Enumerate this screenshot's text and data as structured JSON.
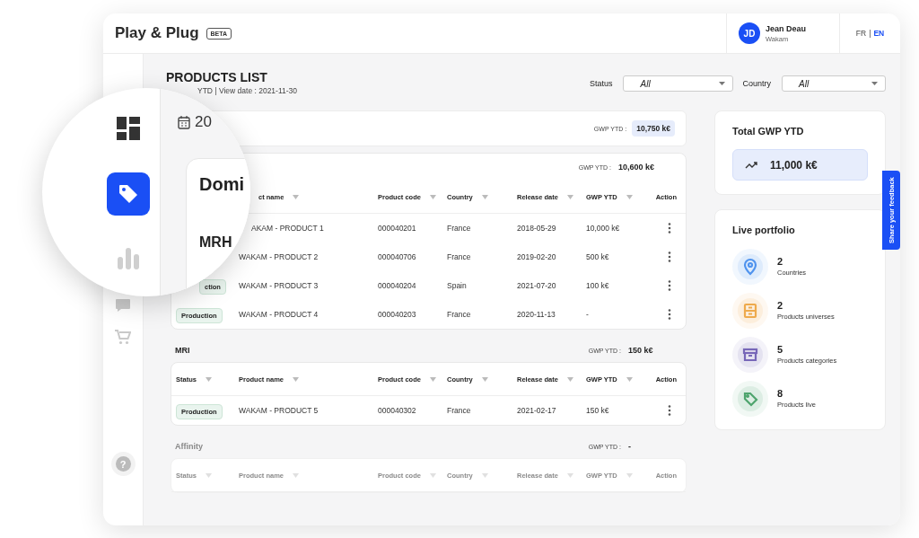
{
  "header": {
    "logo": "Play & Plug",
    "badge": "BETA",
    "user": {
      "initials": "JD",
      "name": "Jean Deau",
      "company": "Wakam"
    },
    "languages": [
      {
        "label": "FR",
        "selected": false
      },
      {
        "label": "EN",
        "selected": true
      }
    ],
    "separator": "|"
  },
  "sidebar": {
    "items": [
      {
        "kind": "chat"
      },
      {
        "kind": "cart"
      }
    ],
    "help": "?"
  },
  "magnifier": {
    "nav": [
      {
        "kind": "dashboard",
        "selected": false
      },
      {
        "kind": "tag",
        "selected": true
      },
      {
        "kind": "chart",
        "selected": false
      }
    ],
    "date": "20",
    "group_title": "Domi",
    "section_title": "MRH"
  },
  "page": {
    "title": "PRODUCTS LIST",
    "subtitle": "YTD | View date : 2021-11-30",
    "filters": [
      {
        "label": "Status",
        "value": "All"
      },
      {
        "label": "Country",
        "value": "All"
      }
    ]
  },
  "group": {
    "gwp_label": "GWP YTD :",
    "gwp": "10,750 k€",
    "sections": [
      {
        "kind": "card",
        "gwp_label": "GWP YTD :",
        "gwp": "10,600 k€",
        "dimmed": false,
        "columns": [
          {
            "label": "ct name",
            "filter": true
          },
          {
            "label": "Product code",
            "filter": true
          },
          {
            "label": "Country",
            "filter": true
          },
          {
            "label": "Release date",
            "filter": true
          },
          {
            "label": "GWP YTD",
            "filter": true
          },
          {
            "label": "Action",
            "filter": false
          }
        ],
        "rows": [
          {
            "name": "AKAM - PRODUCT 1",
            "code": "000040201",
            "country": "France",
            "date": "2018-05-29",
            "gwp": "10,000 k€"
          },
          {
            "name": "WAKAM - PRODUCT 2",
            "code": "000040706",
            "country": "France",
            "date": "2019-02-20",
            "gwp": "500 k€"
          },
          {
            "status": "ction",
            "name": "WAKAM - PRODUCT 3",
            "code": "000040204",
            "country": "Spain",
            "date": "2021-07-20",
            "gwp": "100 k€"
          },
          {
            "status": "Production",
            "name": "WAKAM - PRODUCT 4",
            "code": "000040203",
            "country": "France",
            "date": "2020-11-13",
            "gwp": "-"
          }
        ]
      },
      {
        "kind": "plain",
        "title": "MRI",
        "gwp_label": "GWP YTD :",
        "gwp": "150 k€",
        "dimmed": false,
        "columns": [
          {
            "label": "Status",
            "filter": true
          },
          {
            "label": "Product name",
            "filter": true
          },
          {
            "label": "Product code",
            "filter": true
          },
          {
            "label": "Country",
            "filter": true
          },
          {
            "label": "Release date",
            "filter": true
          },
          {
            "label": "GWP YTD",
            "filter": true
          },
          {
            "label": "Action",
            "filter": false
          }
        ],
        "rows": [
          {
            "status": "Production",
            "name": "WAKAM - PRODUCT 5",
            "code": "000040302",
            "country": "France",
            "date": "2021-02-17",
            "gwp": "150 k€"
          }
        ]
      },
      {
        "kind": "plain",
        "title": "Affinity",
        "gwp_label": "GWP YTD :",
        "gwp": "-",
        "dimmed": true,
        "columns": [
          {
            "label": "Status",
            "filter": true
          },
          {
            "label": "Product name",
            "filter": true
          },
          {
            "label": "Product code",
            "filter": true
          },
          {
            "label": "Country",
            "filter": true
          },
          {
            "label": "Release date",
            "filter": true
          },
          {
            "label": "GWP YTD",
            "filter": true
          },
          {
            "label": "Action",
            "filter": false
          }
        ]
      }
    ]
  },
  "summary": {
    "title": "Total GWP YTD",
    "value": "11,000 k€"
  },
  "portfolio": {
    "title": "Live portfolio",
    "items": [
      {
        "kind": "location",
        "value": "2",
        "label": "Countries",
        "color": "#4f93ee"
      },
      {
        "kind": "drawer",
        "value": "2",
        "label": "Products universes",
        "color": "#eeaa4c"
      },
      {
        "kind": "archive",
        "value": "5",
        "label": "Products categories",
        "color": "#7767b8"
      },
      {
        "kind": "tag",
        "value": "8",
        "label": "Products live",
        "color": "#4ea46d"
      }
    ]
  },
  "feedback": "Share your feedback"
}
